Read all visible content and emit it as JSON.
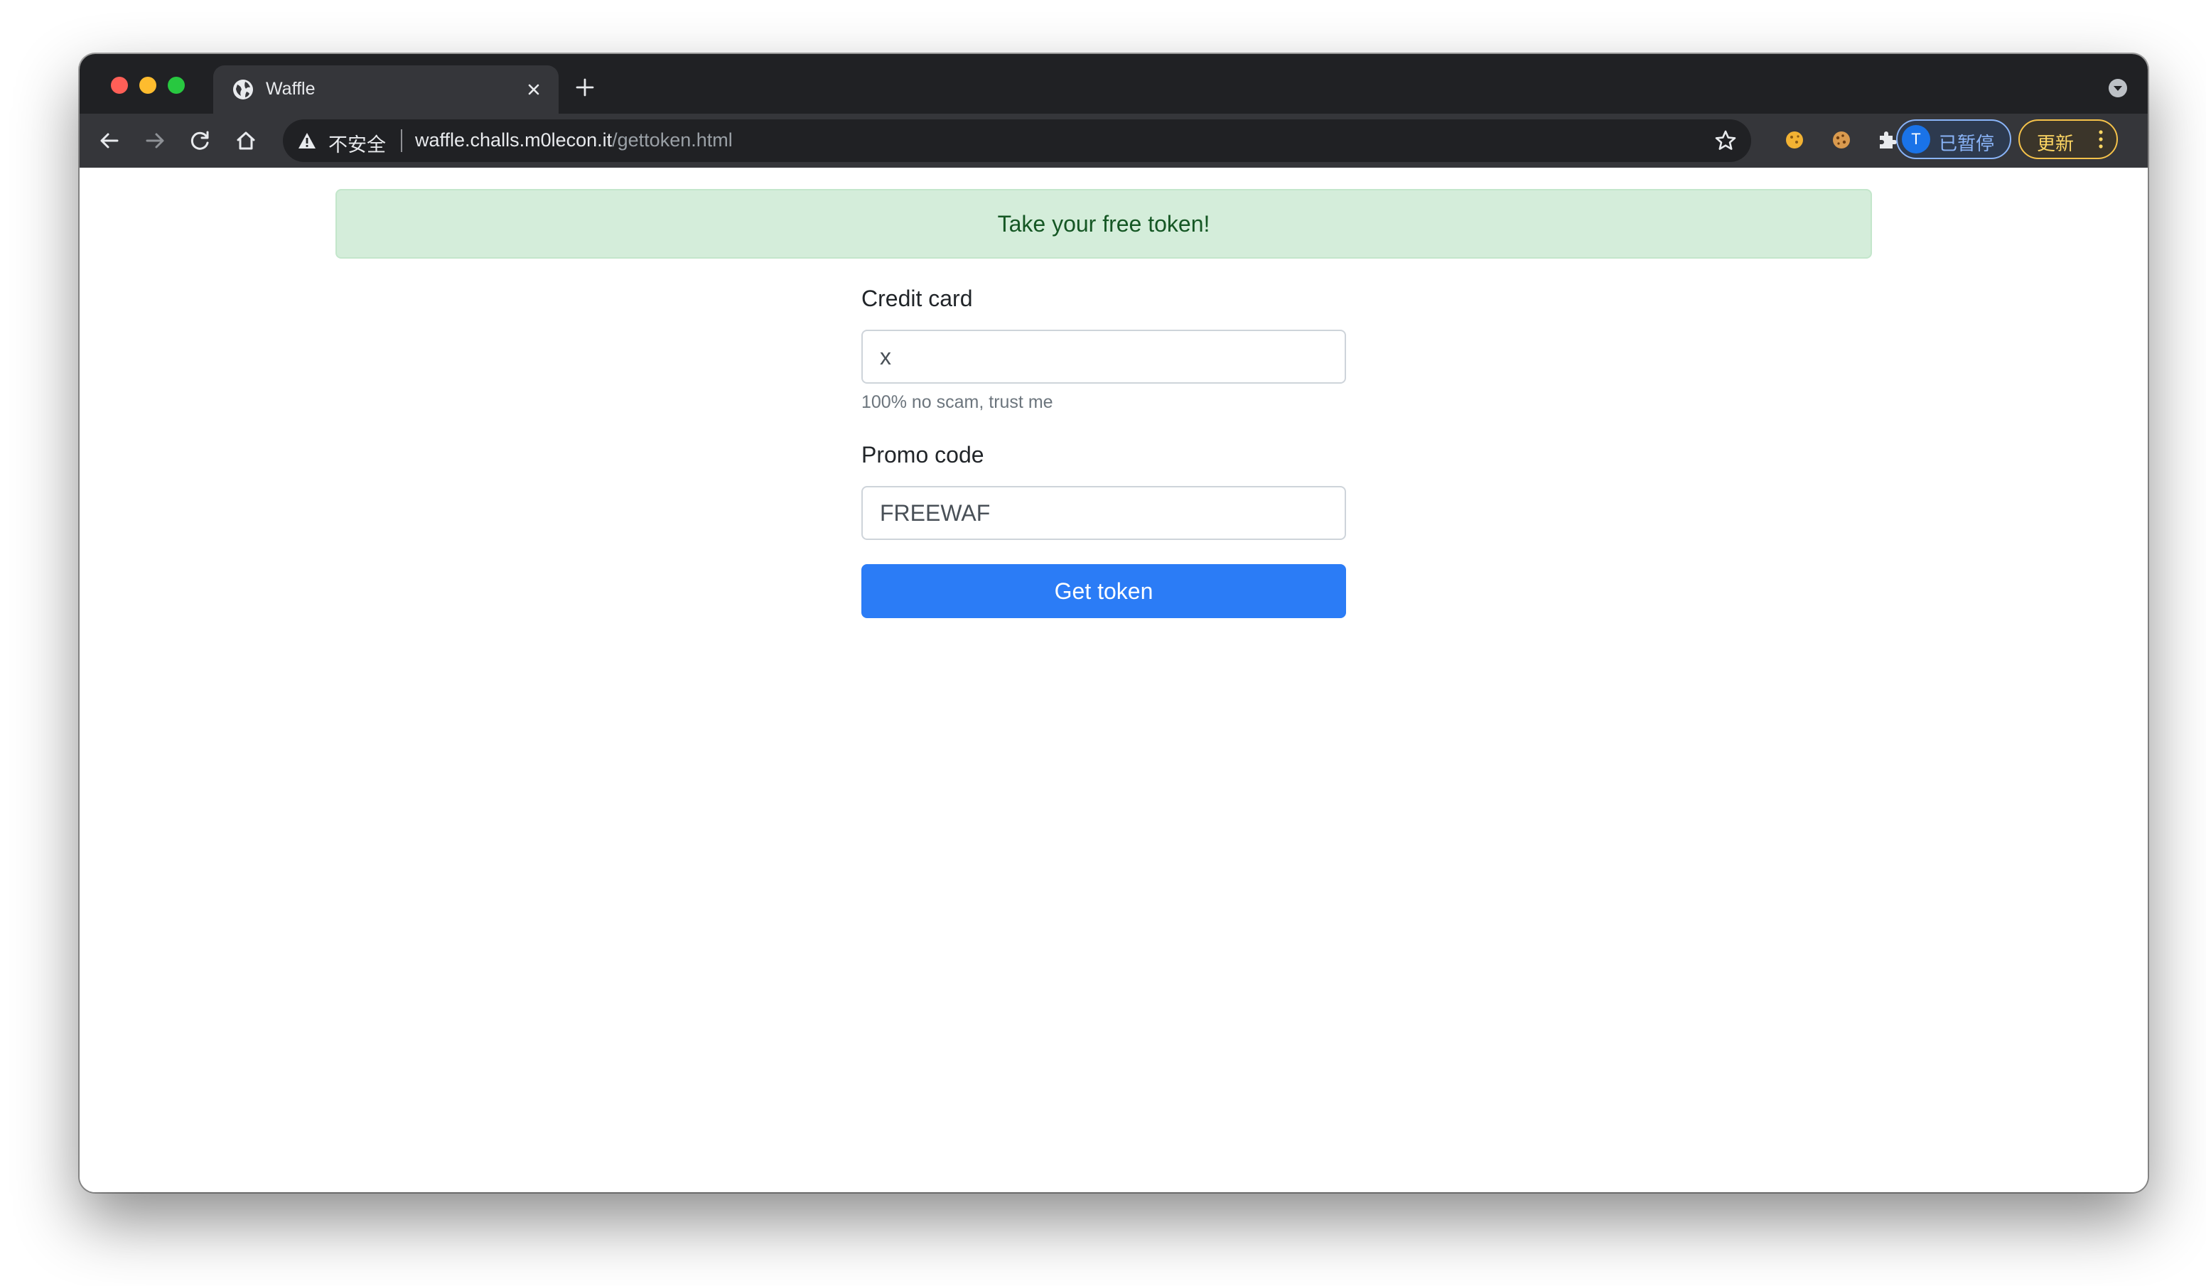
{
  "browser": {
    "tab": {
      "title": "Waffle",
      "favicon": "globe-icon"
    },
    "address_bar": {
      "security_label": "不安全",
      "url_host": "waffle.challs.m0lecon.it",
      "url_path": "/gettoken.html"
    },
    "profile": {
      "avatar_letter": "T",
      "status": "已暂停"
    },
    "update_label": "更新",
    "icons": [
      "back-arrow-icon",
      "forward-arrow-icon",
      "reload-icon",
      "home-icon",
      "warning-icon",
      "star-icon",
      "cookie-extension-icon",
      "cookie-editor-extension-icon",
      "puzzle-icon",
      "more-vertical-icon"
    ]
  },
  "page": {
    "alert": "Take your free token!",
    "credit_card": {
      "label": "Credit card",
      "value": "x",
      "help": "100% no scam, trust me"
    },
    "promo_code": {
      "label": "Promo code",
      "value": "FREEWAF"
    },
    "submit_label": "Get token"
  },
  "colors": {
    "alert_bg": "#d4edda",
    "alert_text": "#155724",
    "button_bg": "#2b7cf6",
    "browser_dark": "#202124",
    "toolbar": "#35363a"
  }
}
